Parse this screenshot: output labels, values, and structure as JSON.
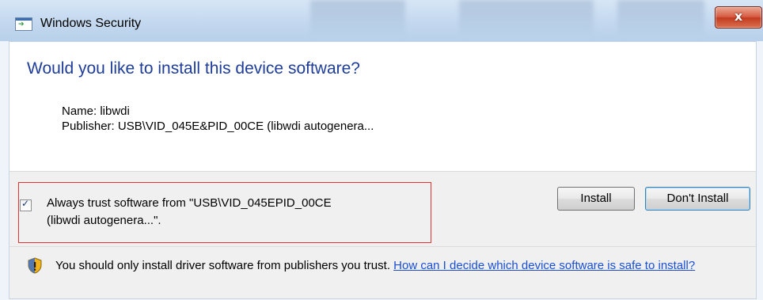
{
  "window": {
    "title": "Windows Security",
    "close_label": "x"
  },
  "main": {
    "headline": "Would you like to install this device software?",
    "name_line": "Name: libwdi",
    "publisher_line": "Publisher: USB\\VID_045E&PID_00CE (libwdi autogenera..."
  },
  "trust": {
    "checked": true,
    "check_mark": "✓",
    "line1": "Always trust software from \"USB\\VID_045EPID_00CE",
    "line2": "(libwdi autogenera...\"."
  },
  "buttons": {
    "install": "Install",
    "dont_install": "Don't Install"
  },
  "warning": {
    "text": "You should only install driver software from publishers you trust.",
    "link": "How can I decide which device software is safe to install?",
    "icon": "shield-warning-icon"
  },
  "colors": {
    "headline": "#1e3d9a",
    "link": "#1a4fd6",
    "highlight_box": "#e23232",
    "close_button": "#c23a1f"
  }
}
